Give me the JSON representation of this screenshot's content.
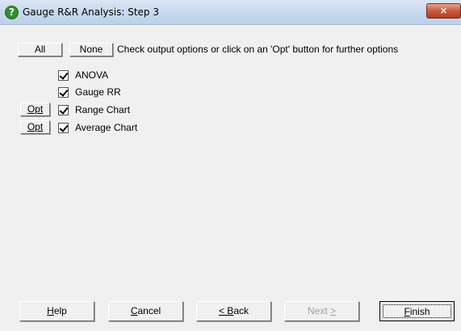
{
  "window": {
    "title": "Gauge R&R Analysis: Step 3",
    "close_label": "×"
  },
  "toolbar": {
    "all_label": "All",
    "none_label": "None",
    "instruction": "Check output options or click on an 'Opt' button for further options"
  },
  "options": [
    {
      "label": "ANOVA",
      "checked": true,
      "has_opt": false
    },
    {
      "label": "Gauge RR",
      "checked": true,
      "has_opt": false
    },
    {
      "label": "Range Chart",
      "checked": true,
      "has_opt": true
    },
    {
      "label": "Average Chart",
      "checked": true,
      "has_opt": true
    }
  ],
  "opt_label": "Opt",
  "buttons": {
    "help": {
      "pre": "",
      "u": "H",
      "post": "elp"
    },
    "cancel": {
      "pre": "",
      "u": "C",
      "post": "ancel"
    },
    "back": {
      "pre": "",
      "u": "< B",
      "post": "ack"
    },
    "next": {
      "pre": "Next ",
      "u": ">",
      "post": ""
    },
    "finish": {
      "pre": "",
      "u": "F",
      "post": "inish"
    }
  }
}
